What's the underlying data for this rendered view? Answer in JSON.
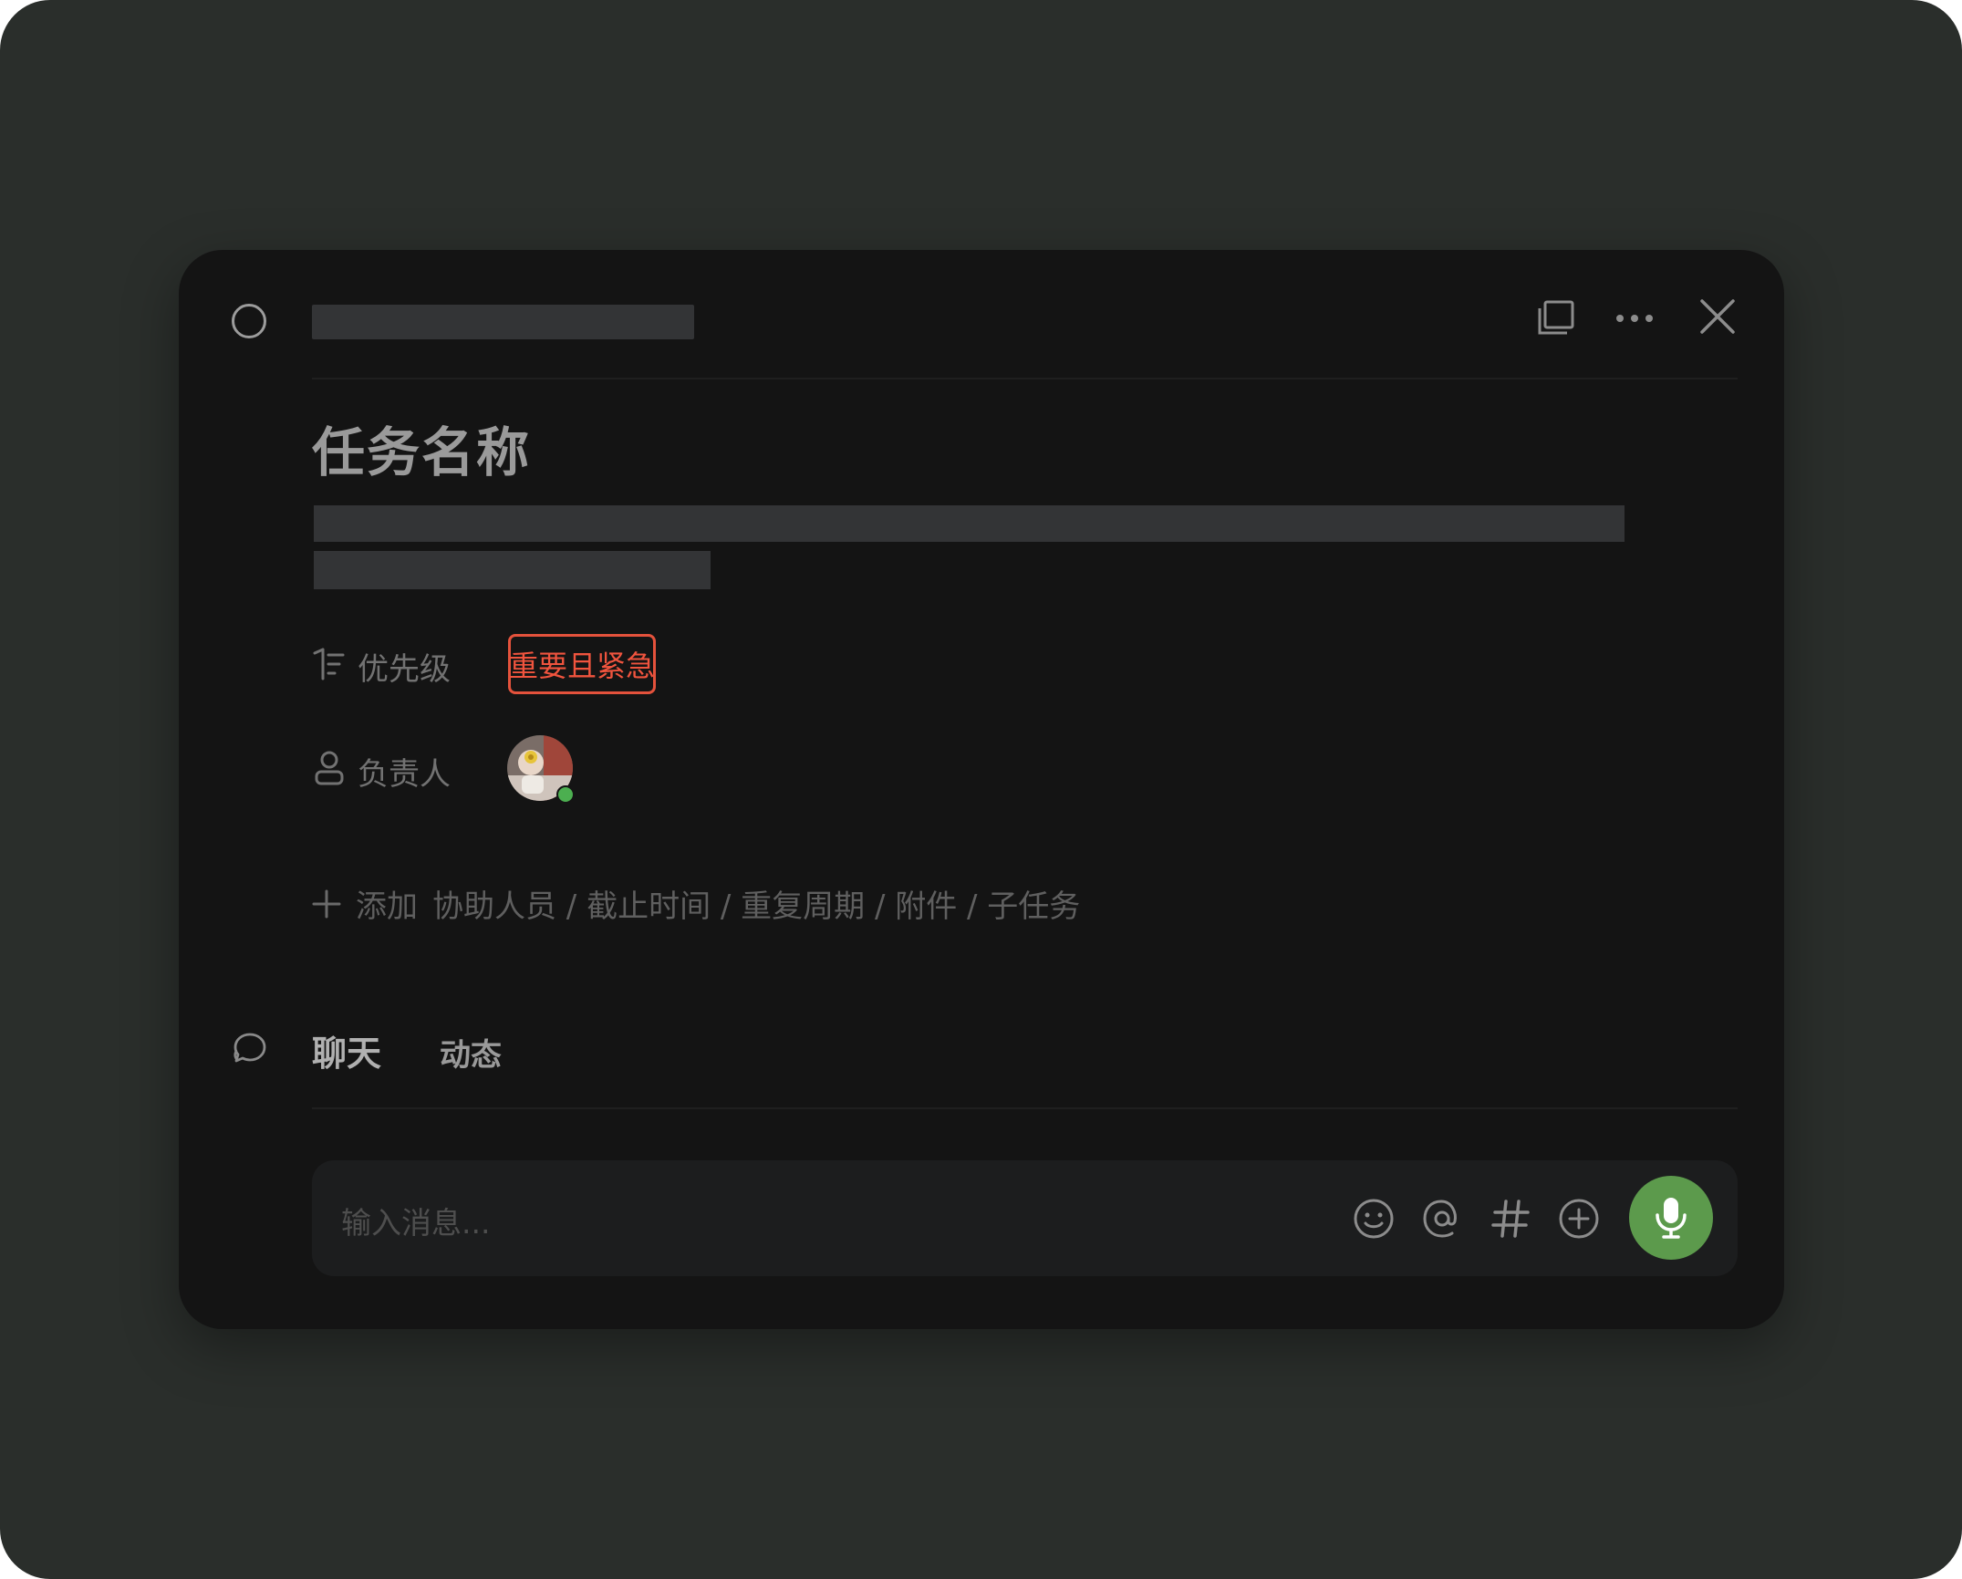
{
  "task": {
    "title": "任务名称"
  },
  "fields": {
    "priority": {
      "label": "优先级",
      "value": "重要且紧急",
      "color": "#f0543e"
    },
    "assignee": {
      "label": "负责人",
      "online_color": "#4caf50"
    }
  },
  "add_row": {
    "add_label": "添加",
    "options_text": "协助人员 / 截止时间 / 重复周期 / 附件 / 子任务"
  },
  "tabs": [
    {
      "label": "聊天",
      "active": true
    },
    {
      "label": "动态",
      "active": false
    }
  ],
  "composer": {
    "placeholder": "输入消息...",
    "mic_color": "#5c9a4c"
  },
  "icons": {
    "status": "circle-status-icon",
    "window": "window-icon",
    "more": "more-icon",
    "close": "close-icon",
    "priority": "priority-icon",
    "person": "person-icon",
    "plus": "plus-icon",
    "chat": "chat-icon",
    "emoji": "emoji-icon",
    "mention": "at-icon",
    "topic": "hash-icon",
    "add": "add-circle-icon",
    "mic": "microphone-icon"
  }
}
